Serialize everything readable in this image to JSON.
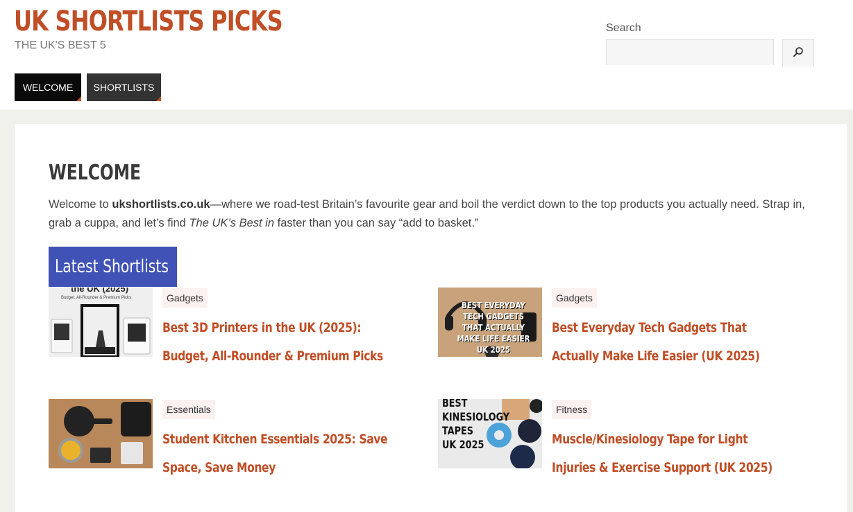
{
  "site": {
    "title": "UK SHORTLISTS PICKS",
    "tagline": "THE UK'S BEST 5"
  },
  "search": {
    "label": "Search",
    "value": "",
    "button_icon": "search-icon"
  },
  "nav": [
    {
      "label": "WELCOME",
      "active": true
    },
    {
      "label": "SHORTLISTS",
      "active": false
    }
  ],
  "page": {
    "title": "WELCOME",
    "intro": {
      "part1": "Welcome to ",
      "site_name": "ukshortlists.co.uk",
      "part2": "—where we road-test Britain’s favourite gear and boil the verdict down to the top products you actually need. Strap in, grab a cuppa, and let’s find ",
      "emph": "The UK’s Best in",
      "part3": " faster than you can say “add to basket.”"
    }
  },
  "latest": {
    "heading": "Latest Shortlists",
    "posts": [
      {
        "category": "Gadgets",
        "title": "Best 3D Printers in the UK (2025): Budget, All-Rounder & Premium Picks",
        "thumb_caption": "the UK (2025)",
        "thumb_subcaption": "Budget, All-Rounder & Premium Picks"
      },
      {
        "category": "Gadgets",
        "title": "Best Everyday Tech Gadgets That Actually Make Life Easier (UK 2025)",
        "thumb_caption": "BEST EVERYDAY TECH GADGETS THAT ACTUALLY MAKE LIFE EASIER UK 2025"
      },
      {
        "category": "Essentials",
        "title": "Student Kitchen Essentials 2025: Save Space, Save Money"
      },
      {
        "category": "Fitness",
        "title": "Muscle/Kinesiology Tape for Light Injuries & Exercise Support (UK 2025)",
        "thumb_caption_lines": [
          "BEST",
          "KINESIOLOGY",
          "TAPES",
          "UK 2025"
        ]
      }
    ]
  },
  "colors": {
    "brand": "#c04e26",
    "heading_bg": "#4052b5",
    "nav_active": "#0a0a0a",
    "nav_inactive": "#333333",
    "badge_bg": "#fbf1ef"
  }
}
